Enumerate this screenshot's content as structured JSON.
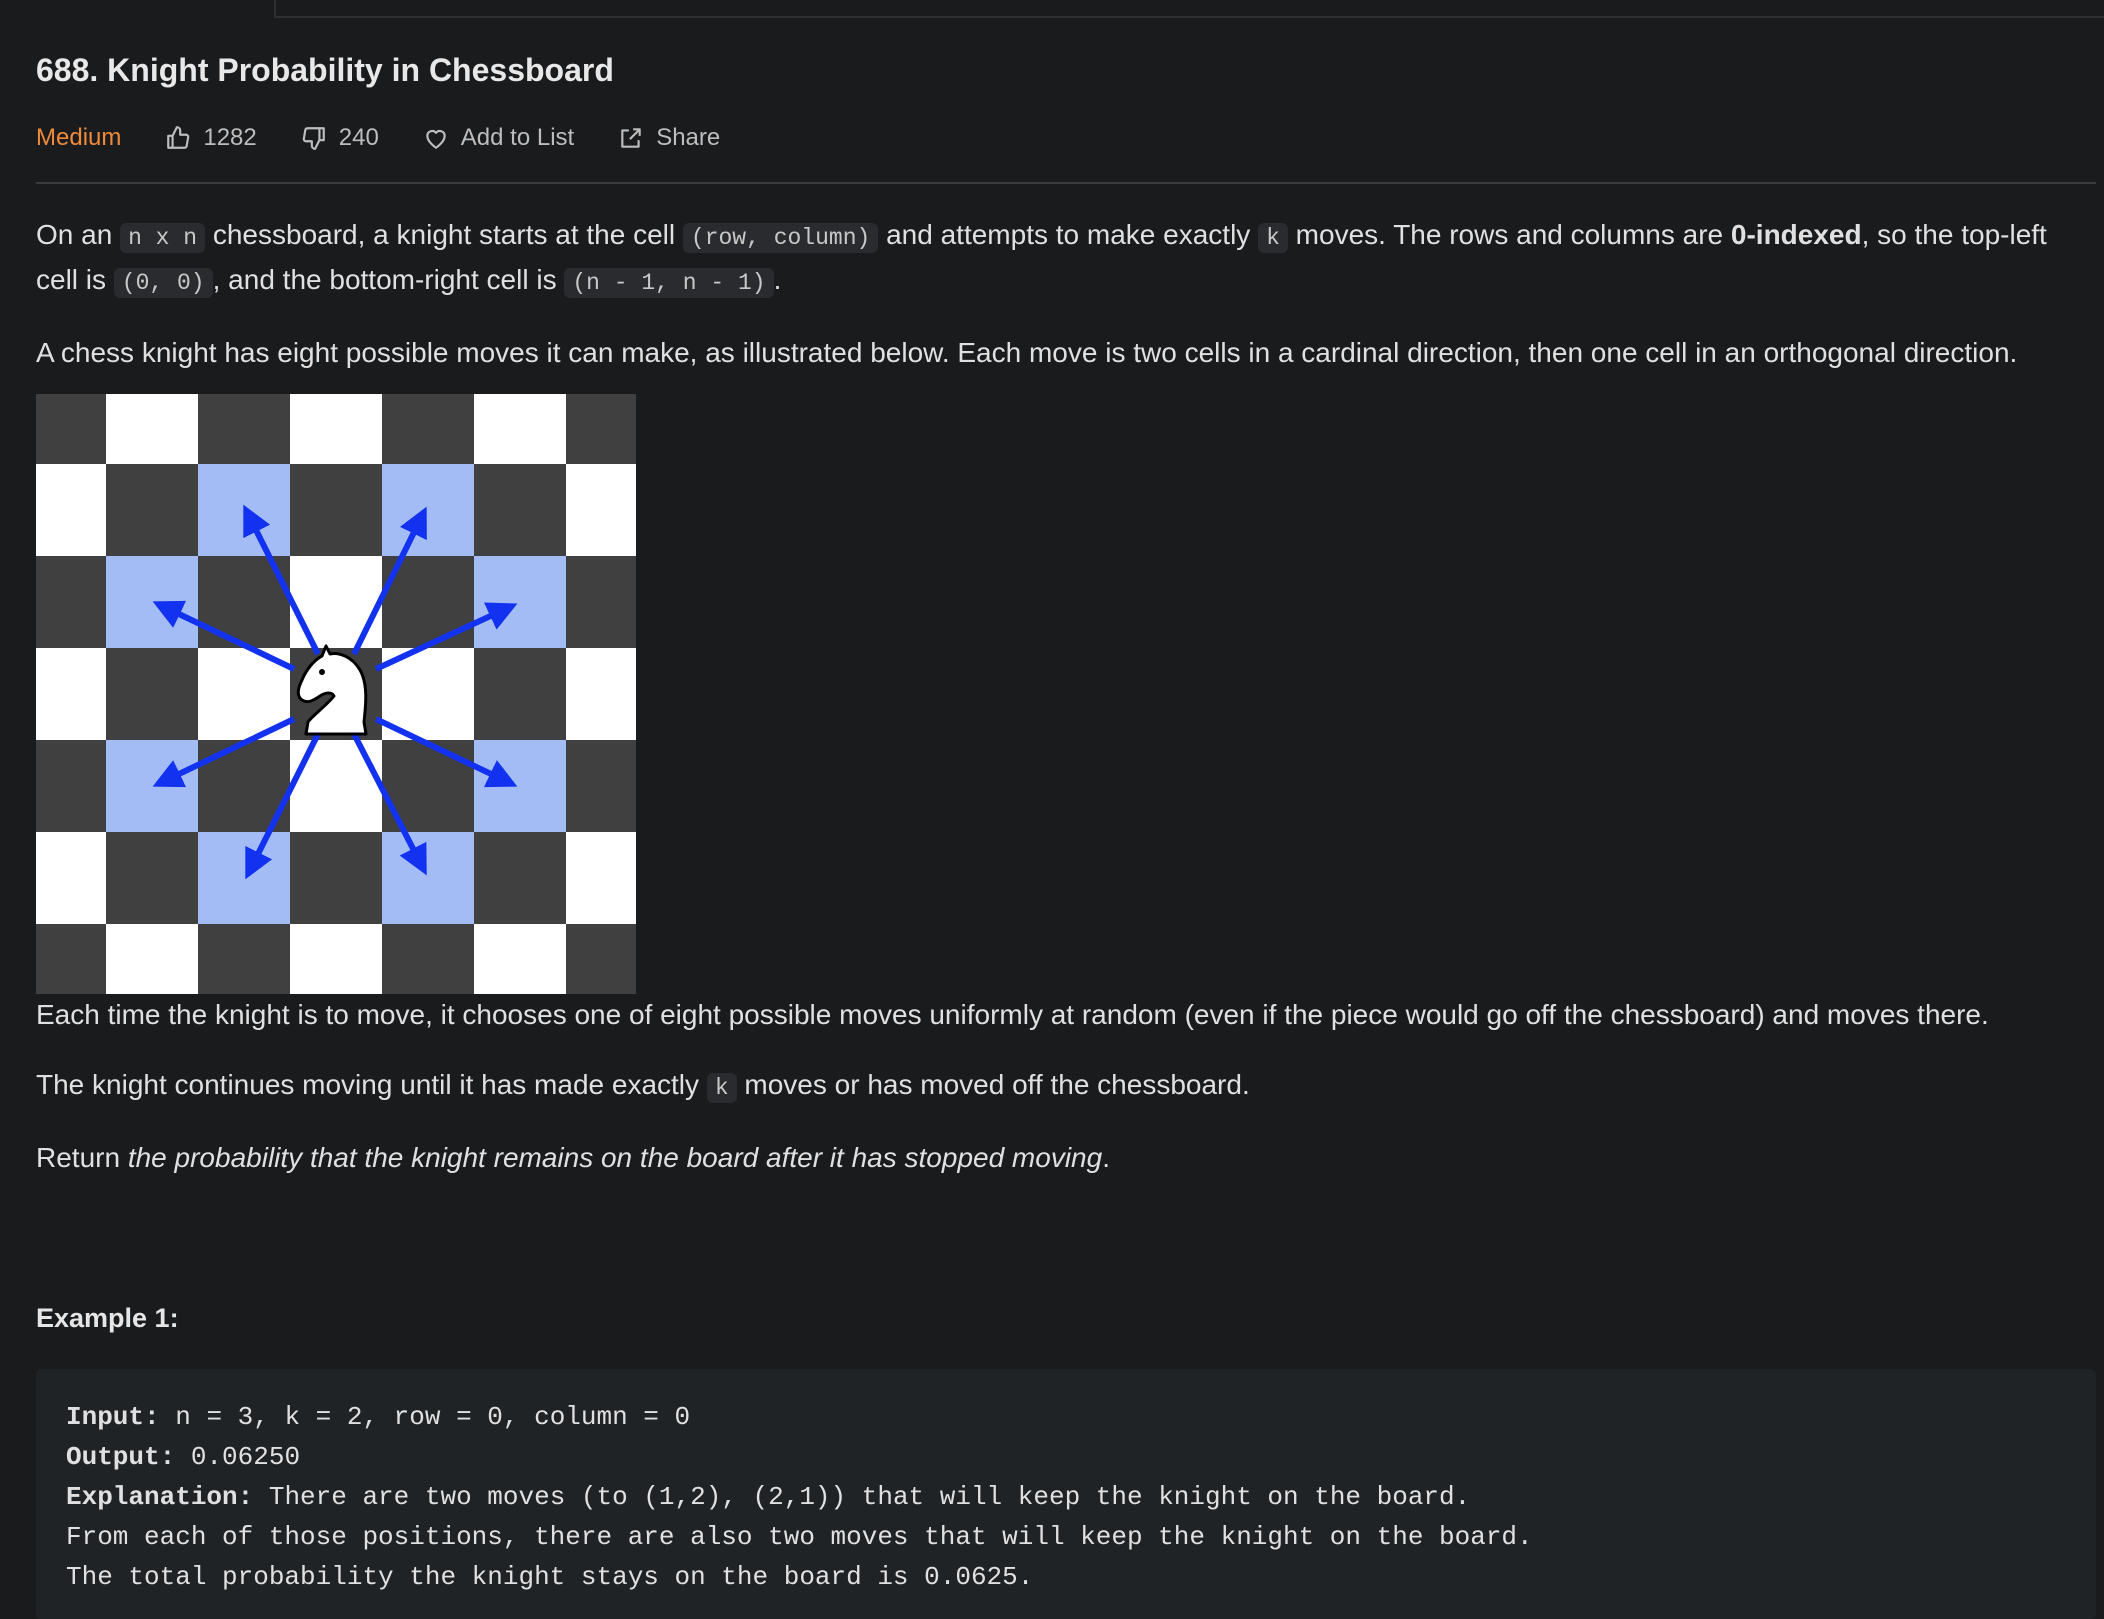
{
  "problem": {
    "title": "688. Knight Probability in Chessboard",
    "difficulty": "Medium",
    "likes": "1282",
    "dislikes": "240",
    "add_to_list": "Add to List",
    "share": "Share"
  },
  "colors": {
    "difficulty": "#ef8a3a",
    "highlight": "#a4bcf6",
    "arrow": "#1232f0"
  },
  "icons": [
    "thumbs-up-icon",
    "thumbs-down-icon",
    "heart-icon",
    "share-icon",
    "knight-icon"
  ],
  "description": {
    "p1_a": "On an",
    "p1_code1": "n x n",
    "p1_b": "chessboard, a knight starts at the cell",
    "p1_code2": "(row, column)",
    "p1_c": "and attempts to make exactly",
    "p1_code3": "k",
    "p1_d": "moves. The rows and columns are",
    "p1_bold": "0-indexed",
    "p1_e": ", so the top-left cell is",
    "p1_code4": "(0, 0)",
    "p1_f": ", and the bottom-right cell is",
    "p1_code5": "(n - 1, n - 1)",
    "p1_g": ".",
    "p2": "A chess knight has eight possible moves it can make, as illustrated below. Each move is two cells in a cardinal direction, then one cell in an orthogonal direction.",
    "p4": "Each time the knight is to move, it chooses one of eight possible moves uniformly at random (even if the piece would go off the chessboard) and moves there.",
    "p5_a": "The knight continues moving until it has made exactly",
    "p5_code": "k",
    "p5_b": "moves or has moved off the chessboard.",
    "p6_a": "Return",
    "p6_em": "the probability that the knight remains on the board after it has stopped moving",
    "p6_b": "."
  },
  "example": {
    "title": "Example 1:",
    "input_label": "Input:",
    "input_value": "n = 3, k = 2, row = 0, column = 0",
    "output_label": "Output:",
    "output_value": "0.06250",
    "explanation_label": "Explanation:",
    "explanation_line1": "There are two moves (to (1,2), (2,1)) that will keep the knight on the board.",
    "explanation_line2": "From each of those positions, there are also two moves that will keep the knight on the board.",
    "explanation_line3": "The total probability the knight stays on the board is 0.0625."
  }
}
